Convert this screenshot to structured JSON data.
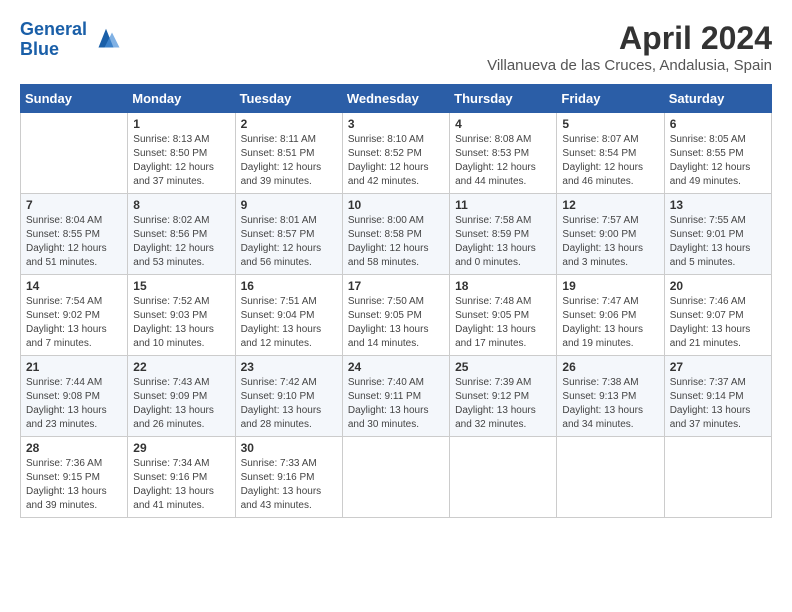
{
  "header": {
    "logo_line1": "General",
    "logo_line2": "Blue",
    "month": "April 2024",
    "location": "Villanueva de las Cruces, Andalusia, Spain"
  },
  "weekdays": [
    "Sunday",
    "Monday",
    "Tuesday",
    "Wednesday",
    "Thursday",
    "Friday",
    "Saturday"
  ],
  "weeks": [
    [
      {
        "day": "",
        "info": ""
      },
      {
        "day": "1",
        "info": "Sunrise: 8:13 AM\nSunset: 8:50 PM\nDaylight: 12 hours\nand 37 minutes."
      },
      {
        "day": "2",
        "info": "Sunrise: 8:11 AM\nSunset: 8:51 PM\nDaylight: 12 hours\nand 39 minutes."
      },
      {
        "day": "3",
        "info": "Sunrise: 8:10 AM\nSunset: 8:52 PM\nDaylight: 12 hours\nand 42 minutes."
      },
      {
        "day": "4",
        "info": "Sunrise: 8:08 AM\nSunset: 8:53 PM\nDaylight: 12 hours\nand 44 minutes."
      },
      {
        "day": "5",
        "info": "Sunrise: 8:07 AM\nSunset: 8:54 PM\nDaylight: 12 hours\nand 46 minutes."
      },
      {
        "day": "6",
        "info": "Sunrise: 8:05 AM\nSunset: 8:55 PM\nDaylight: 12 hours\nand 49 minutes."
      }
    ],
    [
      {
        "day": "7",
        "info": "Sunrise: 8:04 AM\nSunset: 8:55 PM\nDaylight: 12 hours\nand 51 minutes."
      },
      {
        "day": "8",
        "info": "Sunrise: 8:02 AM\nSunset: 8:56 PM\nDaylight: 12 hours\nand 53 minutes."
      },
      {
        "day": "9",
        "info": "Sunrise: 8:01 AM\nSunset: 8:57 PM\nDaylight: 12 hours\nand 56 minutes."
      },
      {
        "day": "10",
        "info": "Sunrise: 8:00 AM\nSunset: 8:58 PM\nDaylight: 12 hours\nand 58 minutes."
      },
      {
        "day": "11",
        "info": "Sunrise: 7:58 AM\nSunset: 8:59 PM\nDaylight: 13 hours\nand 0 minutes."
      },
      {
        "day": "12",
        "info": "Sunrise: 7:57 AM\nSunset: 9:00 PM\nDaylight: 13 hours\nand 3 minutes."
      },
      {
        "day": "13",
        "info": "Sunrise: 7:55 AM\nSunset: 9:01 PM\nDaylight: 13 hours\nand 5 minutes."
      }
    ],
    [
      {
        "day": "14",
        "info": "Sunrise: 7:54 AM\nSunset: 9:02 PM\nDaylight: 13 hours\nand 7 minutes."
      },
      {
        "day": "15",
        "info": "Sunrise: 7:52 AM\nSunset: 9:03 PM\nDaylight: 13 hours\nand 10 minutes."
      },
      {
        "day": "16",
        "info": "Sunrise: 7:51 AM\nSunset: 9:04 PM\nDaylight: 13 hours\nand 12 minutes."
      },
      {
        "day": "17",
        "info": "Sunrise: 7:50 AM\nSunset: 9:05 PM\nDaylight: 13 hours\nand 14 minutes."
      },
      {
        "day": "18",
        "info": "Sunrise: 7:48 AM\nSunset: 9:05 PM\nDaylight: 13 hours\nand 17 minutes."
      },
      {
        "day": "19",
        "info": "Sunrise: 7:47 AM\nSunset: 9:06 PM\nDaylight: 13 hours\nand 19 minutes."
      },
      {
        "day": "20",
        "info": "Sunrise: 7:46 AM\nSunset: 9:07 PM\nDaylight: 13 hours\nand 21 minutes."
      }
    ],
    [
      {
        "day": "21",
        "info": "Sunrise: 7:44 AM\nSunset: 9:08 PM\nDaylight: 13 hours\nand 23 minutes."
      },
      {
        "day": "22",
        "info": "Sunrise: 7:43 AM\nSunset: 9:09 PM\nDaylight: 13 hours\nand 26 minutes."
      },
      {
        "day": "23",
        "info": "Sunrise: 7:42 AM\nSunset: 9:10 PM\nDaylight: 13 hours\nand 28 minutes."
      },
      {
        "day": "24",
        "info": "Sunrise: 7:40 AM\nSunset: 9:11 PM\nDaylight: 13 hours\nand 30 minutes."
      },
      {
        "day": "25",
        "info": "Sunrise: 7:39 AM\nSunset: 9:12 PM\nDaylight: 13 hours\nand 32 minutes."
      },
      {
        "day": "26",
        "info": "Sunrise: 7:38 AM\nSunset: 9:13 PM\nDaylight: 13 hours\nand 34 minutes."
      },
      {
        "day": "27",
        "info": "Sunrise: 7:37 AM\nSunset: 9:14 PM\nDaylight: 13 hours\nand 37 minutes."
      }
    ],
    [
      {
        "day": "28",
        "info": "Sunrise: 7:36 AM\nSunset: 9:15 PM\nDaylight: 13 hours\nand 39 minutes."
      },
      {
        "day": "29",
        "info": "Sunrise: 7:34 AM\nSunset: 9:16 PM\nDaylight: 13 hours\nand 41 minutes."
      },
      {
        "day": "30",
        "info": "Sunrise: 7:33 AM\nSunset: 9:16 PM\nDaylight: 13 hours\nand 43 minutes."
      },
      {
        "day": "",
        "info": ""
      },
      {
        "day": "",
        "info": ""
      },
      {
        "day": "",
        "info": ""
      },
      {
        "day": "",
        "info": ""
      }
    ]
  ]
}
